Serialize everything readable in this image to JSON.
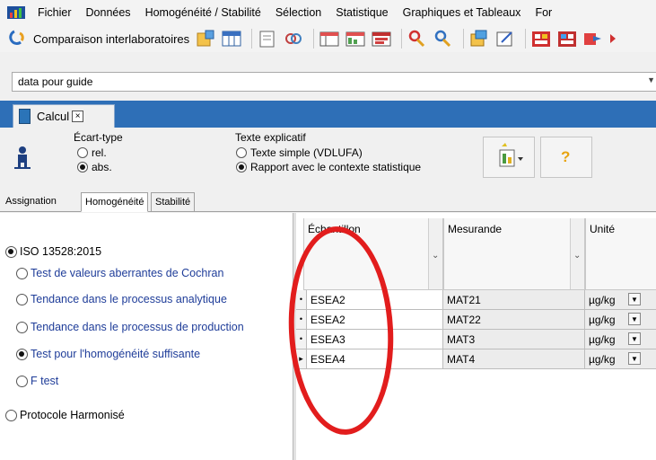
{
  "menu": [
    "Fichier",
    "Données",
    "Homogénéité / Stabilité",
    "Sélection",
    "Statistique",
    "Graphiques et Tableaux",
    "For"
  ],
  "toolbar": {
    "mode_label": "Comparaison interlaboratoires"
  },
  "dataset": {
    "value": "data pour guide"
  },
  "doc_tab": {
    "label": "Calcul",
    "close": "×"
  },
  "options": {
    "ecart_type": {
      "title": "Écart-type",
      "rel": "rel.",
      "abs": "abs.",
      "selected": "abs."
    },
    "texte": {
      "title": "Texte explicatif",
      "simple": "Texte simple (VDLUFA)",
      "rapport": "Rapport avec le contexte statistique",
      "selected": "rapport"
    },
    "help_glyph": "?"
  },
  "subtabs": [
    "Assignation",
    "Homogénéité",
    "Stabilité"
  ],
  "active_subtab": "Homogénéité",
  "left_panel": {
    "iso": "ISO 13528:2015",
    "tests": [
      "Test de valeurs aberrantes de Cochran",
      "Tendance dans le processus analytique",
      "Tendance dans le processus de production",
      "Test pour l'homogénéité suffisante",
      "F test"
    ],
    "selected_test": "Test pour l'homogénéité suffisante",
    "protocole": "Protocole Harmonisé"
  },
  "grid": {
    "columns": [
      "Échantillon",
      "Mesurande",
      "Unité"
    ],
    "rows": [
      {
        "indicator": "•",
        "echantillon": "ESEA2",
        "mesurande": "MAT21",
        "unite": "µg/kg"
      },
      {
        "indicator": "•",
        "echantillon": "ESEA2",
        "mesurande": "MAT22",
        "unite": "µg/kg"
      },
      {
        "indicator": "•",
        "echantillon": "ESEA3",
        "mesurande": "MAT3",
        "unite": "µg/kg"
      },
      {
        "indicator": "▸",
        "echantillon": "ESEA4",
        "mesurande": "MAT4",
        "unite": "µg/kg"
      }
    ]
  },
  "colors": {
    "doc_bar": "#2e6fb7",
    "annotation": "#e21d1d",
    "link_text": "#1f3d99"
  }
}
